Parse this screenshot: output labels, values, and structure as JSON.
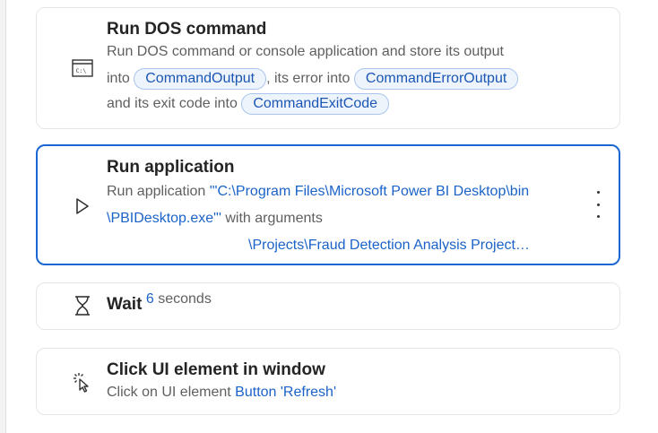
{
  "actions": [
    {
      "title": "Run DOS command",
      "icon": "console-window-icon",
      "desc_line1": "Run DOS command or console application and store its output",
      "into_label": "into",
      "output_var": "CommandOutput",
      "error_label": ", its error into",
      "error_var": "CommandErrorOutput",
      "exit_label": "and its exit code into",
      "exit_var": "CommandExitCode"
    },
    {
      "title": "Run application",
      "icon": "play-icon",
      "desc_prefix": "Run application",
      "path_part1": "'\"C:\\Program Files\\Microsoft Power BI Desktop\\bin",
      "path_part2": "\\PBIDesktop.exe\"'",
      "args_label": "with arguments",
      "args_value": "\\Projects\\Fraud Detection Analysis Project…",
      "selected": true
    },
    {
      "title": "Wait",
      "icon": "hourglass-icon",
      "value": "6",
      "unit": "seconds"
    },
    {
      "title": "Click UI element in window",
      "icon": "click-cursor-icon",
      "desc_prefix": "Click on UI element",
      "element": "Button 'Refresh'"
    }
  ]
}
